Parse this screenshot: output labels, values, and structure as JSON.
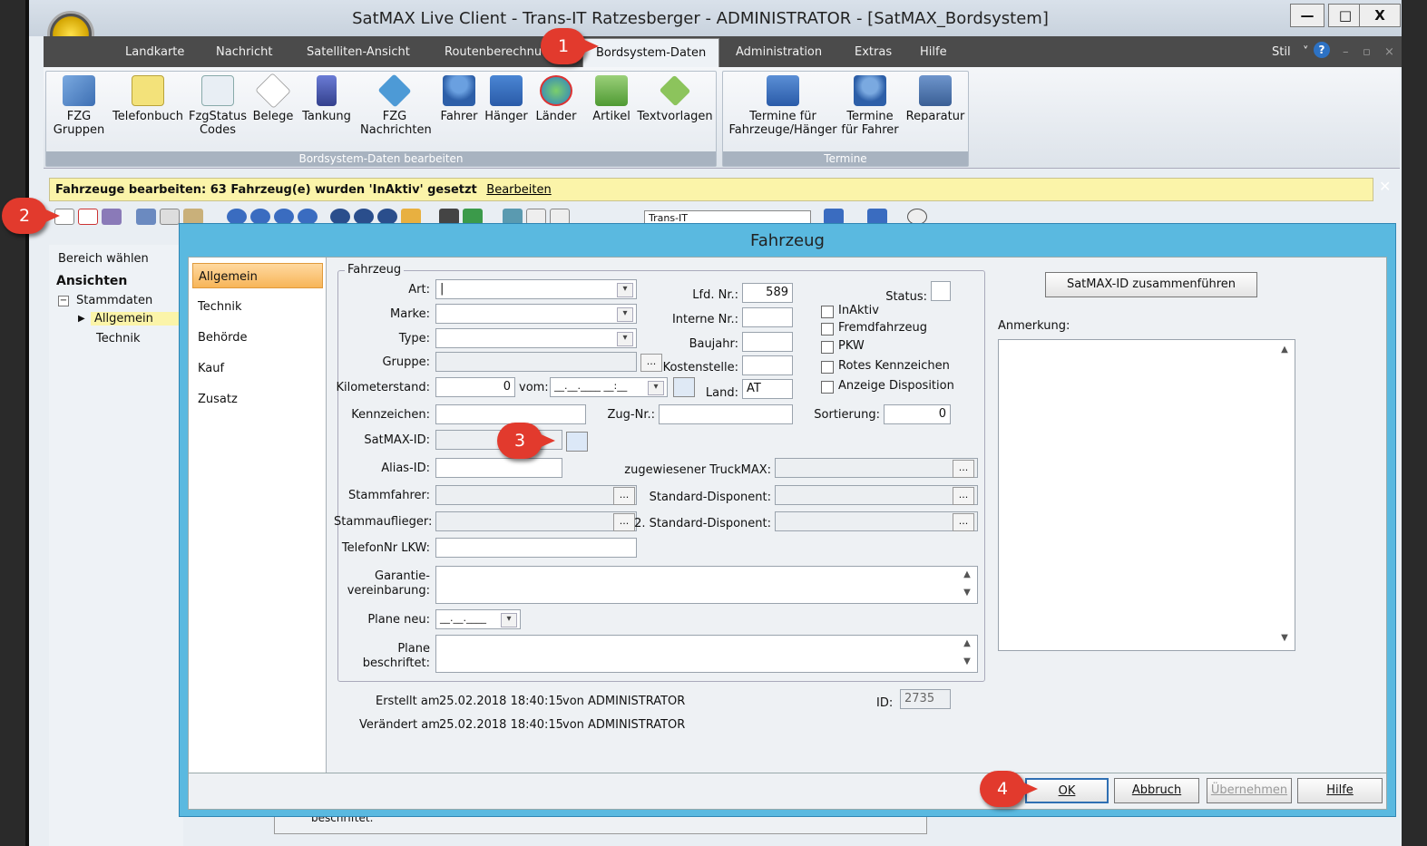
{
  "window": {
    "title": "SatMAX Live Client - Trans-IT Ratzesberger - ADMINISTRATOR - [SatMAX_Bordsystem]",
    "min": "—",
    "max": "□",
    "close": "X"
  },
  "menu": {
    "items": [
      "Landkarte",
      "Nachricht",
      "Satelliten-Ansicht",
      "Routenberechnu",
      "Bordsystem-Daten",
      "Administration",
      "Extras",
      "Hilfe"
    ],
    "style": "Stil",
    "style_chevron": "˅",
    "help": "?",
    "mini": [
      "–",
      "▫",
      "×"
    ]
  },
  "ribbon": {
    "group1_title": "Bordsystem-Daten bearbeiten",
    "group2_title": "Termine",
    "buttons": [
      "FZG\nGruppen",
      "Telefonbuch",
      "FzgStatus\nCodes",
      "Belege",
      "Tankung",
      "FZG\nNachrichten",
      "Fahrer",
      "Hänger",
      "Länder",
      "Artikel",
      "Textvorlagen"
    ],
    "termine": [
      "Termine für\nFahrzeuge/Hänger",
      "Termine\nfür Fahrer",
      "Reparatur"
    ]
  },
  "infobar": {
    "text": "Fahrzeuge bearbeiten: 63 Fahrzeug(e) wurden 'InAktiv' gesetzt",
    "link": "Bearbeiten",
    "close": "✕"
  },
  "toolbar2": {
    "combo": "Trans-IT"
  },
  "left": {
    "bereich": "Bereich wählen",
    "ansichten": "Ansichten",
    "stammdaten": "Stammdaten",
    "allgemein": "Allgemein",
    "technik": "Technik",
    "minus": "−",
    "arrow": "▶"
  },
  "dialog": {
    "title": "Fahrzeug",
    "nav": [
      "Allgemein",
      "Technik",
      "Behörde",
      "Kauf",
      "Zusatz"
    ],
    "legend": "Fahrzeug",
    "labels": {
      "art": "Art:",
      "marke": "Marke:",
      "typ": "Type:",
      "gruppe": "Gruppe:",
      "km": "Kilometerstand:",
      "vom": "vom:",
      "kennz": "Kennzeichen:",
      "zug": "Zug-Nr.:",
      "satmax": "SatMAX-ID:",
      "alias": "Alias-ID:",
      "stammfahrer": "Stammfahrer:",
      "stammauf": "Stammauflieger:",
      "telefon": "TelefonNr LKW:",
      "garantie": "Garantie-\nvereinbarung:",
      "plane_neu": "Plane neu:",
      "plane_beschr": "Plane\nbeschriftet:",
      "lfd": "Lfd. Nr.:",
      "interne": "Interne Nr.:",
      "baujahr": "Baujahr:",
      "kosten": "Kostenstelle:",
      "land": "Land:",
      "status": "Status:",
      "truckmax": "zugewiesener TruckMAX:",
      "std_disp": "Standard-Disponent:",
      "std_disp2": "2. Standard-Disponent:",
      "sortierung": "Sortierung:",
      "anmerkung": "Anmerkung:"
    },
    "values": {
      "art": "|",
      "km": "0",
      "vom": "__.__.____ __:__",
      "lfd": "589",
      "land": "AT",
      "sortierung": "0",
      "plane_neu": "__.__.____"
    },
    "dots": "...",
    "checks": [
      "InAktiv",
      "Fremdfahrzeug",
      "PKW",
      "Rotes Kennzeichen",
      "Anzeige Disposition"
    ],
    "merge_btn": "SatMAX-ID zusammenführen",
    "erstellt_lbl": "Erstellt am",
    "erstellt": "25.02.2018 18:40:15",
    "von1": "von ADMINISTRATOR",
    "veraendert_lbl": "Verändert am",
    "veraendert": "25.02.2018 18:40:15",
    "von2": "von ADMINISTRATOR",
    "id_lbl": "ID:",
    "id": "2735",
    "buttons": {
      "ok": "OK",
      "abbruch": "Abbruch",
      "uebernehmen": "Übernehmen",
      "hilfe": "Hilfe"
    },
    "behind": "beschriftet:"
  },
  "badges": [
    "1",
    "2",
    "3",
    "4"
  ],
  "colors": {
    "accent": "#5ab9e0",
    "badge": "#e23a2d",
    "selected": "#f7b558"
  }
}
